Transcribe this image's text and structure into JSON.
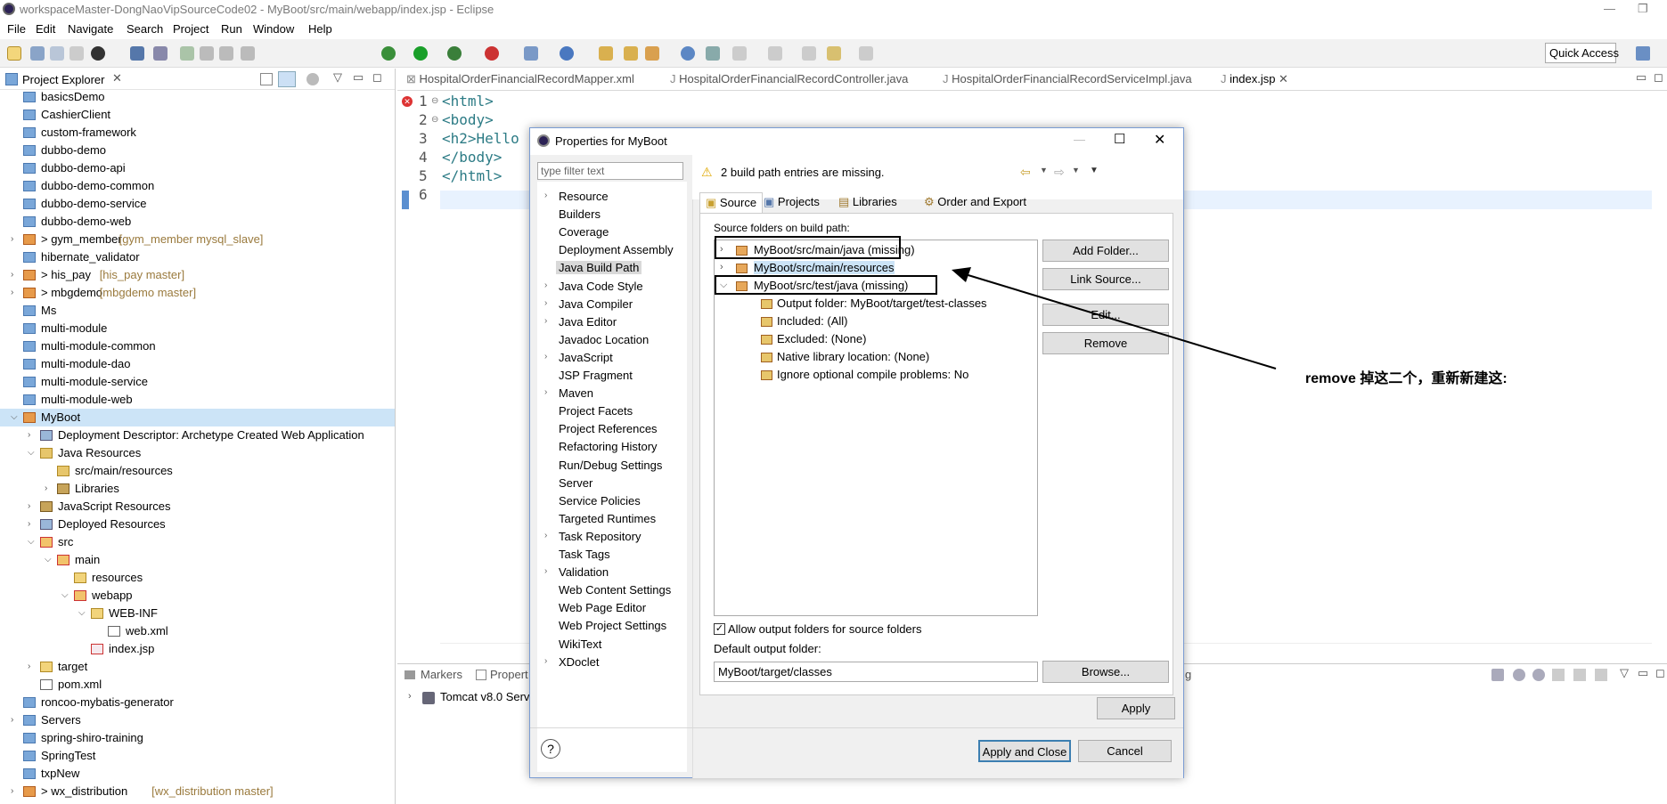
{
  "window": {
    "title": "workspaceMaster-DongNaoVipSourceCode02 - MyBoot/src/main/webapp/index.jsp - Eclipse"
  },
  "menu": [
    "File",
    "Edit",
    "Navigate",
    "Search",
    "Project",
    "Run",
    "Window",
    "Help"
  ],
  "quick_access": "Quick Access",
  "explorer": {
    "title": "Project Explorer",
    "items": [
      {
        "label": "basicsDemo",
        "indent": 0,
        "arrow": "",
        "icon": "proj"
      },
      {
        "label": "CashierClient",
        "indent": 0,
        "arrow": "",
        "icon": "proj"
      },
      {
        "label": "custom-framework",
        "indent": 0,
        "arrow": "",
        "icon": "proj"
      },
      {
        "label": "dubbo-demo",
        "indent": 0,
        "arrow": "",
        "icon": "proj"
      },
      {
        "label": "dubbo-demo-api",
        "indent": 0,
        "arrow": "",
        "icon": "proj"
      },
      {
        "label": "dubbo-demo-common",
        "indent": 0,
        "arrow": "",
        "icon": "proj"
      },
      {
        "label": "dubbo-demo-service",
        "indent": 0,
        "arrow": "",
        "icon": "proj"
      },
      {
        "label": "dubbo-demo-web",
        "indent": 0,
        "arrow": "",
        "icon": "proj"
      },
      {
        "label": "> gym_member",
        "suffix": " [gym_member mysql_slave]",
        "indent": 0,
        "arrow": "›",
        "icon": "maven"
      },
      {
        "label": "hibernate_validator",
        "indent": 0,
        "arrow": "",
        "icon": "proj"
      },
      {
        "label": "> his_pay",
        "suffix": " [his_pay master]",
        "indent": 0,
        "arrow": "›",
        "icon": "maven"
      },
      {
        "label": "> mbgdemo",
        "suffix": " [mbgdemo master]",
        "indent": 0,
        "arrow": "›",
        "icon": "maven"
      },
      {
        "label": "Ms",
        "indent": 0,
        "arrow": "",
        "icon": "proj"
      },
      {
        "label": "multi-module",
        "indent": 0,
        "arrow": "",
        "icon": "proj"
      },
      {
        "label": "multi-module-common",
        "indent": 0,
        "arrow": "",
        "icon": "proj"
      },
      {
        "label": "multi-module-dao",
        "indent": 0,
        "arrow": "",
        "icon": "proj"
      },
      {
        "label": "multi-module-service",
        "indent": 0,
        "arrow": "",
        "icon": "proj"
      },
      {
        "label": "multi-module-web",
        "indent": 0,
        "arrow": "",
        "icon": "proj"
      },
      {
        "label": "MyBoot",
        "indent": 0,
        "arrow": "⌄",
        "icon": "maven",
        "selected": true
      },
      {
        "label": "Deployment Descriptor: Archetype Created Web Application",
        "indent": 1,
        "arrow": "›",
        "icon": "desc"
      },
      {
        "label": "Java Resources",
        "indent": 1,
        "arrow": "⌄",
        "icon": "pkgf"
      },
      {
        "label": "src/main/resources",
        "indent": 2,
        "arrow": "",
        "icon": "pkgf"
      },
      {
        "label": "Libraries",
        "indent": 2,
        "arrow": "›",
        "icon": "lib"
      },
      {
        "label": "JavaScript Resources",
        "indent": 1,
        "arrow": "›",
        "icon": "lib"
      },
      {
        "label": "Deployed Resources",
        "indent": 1,
        "arrow": "›",
        "icon": "desc"
      },
      {
        "label": "src",
        "indent": 1,
        "arrow": "⌄",
        "icon": "redfolder"
      },
      {
        "label": "main",
        "indent": 2,
        "arrow": "⌄",
        "icon": "redfolder"
      },
      {
        "label": "resources",
        "indent": 3,
        "arrow": "",
        "icon": "folder"
      },
      {
        "label": "webapp",
        "indent": 3,
        "arrow": "⌄",
        "icon": "redfolder"
      },
      {
        "label": "WEB-INF",
        "indent": 4,
        "arrow": "⌄",
        "icon": "folder"
      },
      {
        "label": "web.xml",
        "indent": 5,
        "arrow": "",
        "icon": "xml"
      },
      {
        "label": "index.jsp",
        "indent": 4,
        "arrow": "",
        "icon": "jsp"
      },
      {
        "label": "target",
        "indent": 1,
        "arrow": "›",
        "icon": "folder"
      },
      {
        "label": "pom.xml",
        "indent": 1,
        "arrow": "",
        "icon": "pom"
      },
      {
        "label": "roncoo-mybatis-generator",
        "indent": 0,
        "arrow": "",
        "icon": "proj"
      },
      {
        "label": "Servers",
        "indent": 0,
        "arrow": "›",
        "icon": "proj"
      },
      {
        "label": "spring-shiro-training",
        "indent": 0,
        "arrow": "",
        "icon": "proj"
      },
      {
        "label": "SpringTest",
        "indent": 0,
        "arrow": "",
        "icon": "proj"
      },
      {
        "label": "txpNew",
        "indent": 0,
        "arrow": "",
        "icon": "proj"
      },
      {
        "label": "> wx_distribution",
        "suffix": " [wx_distribution master]",
        "indent": 0,
        "arrow": "›",
        "icon": "maven"
      }
    ]
  },
  "editor": {
    "tabs": [
      "HospitalOrderFinancialRecordMapper.xml",
      "HospitalOrderFinancialRecordController.java",
      "HospitalOrderFinancialRecordServiceImpl.java",
      "index.jsp"
    ],
    "lines": [
      {
        "num": "1",
        "text": "<html>"
      },
      {
        "num": "2",
        "text": "<body>"
      },
      {
        "num": "3",
        "text": "<h2>Hello"
      },
      {
        "num": "4",
        "text": "</body>"
      },
      {
        "num": "5",
        "text": "</html>"
      },
      {
        "num": "6",
        "text": ""
      }
    ]
  },
  "bottom": {
    "tab1": "Markers",
    "tab2": "Propert",
    "tab_end": "g",
    "server": "Tomcat v8.0 Serv"
  },
  "dialog": {
    "title": "Properties for MyBoot",
    "filter_placeholder": "type filter text",
    "message": "2 build path entries are missing.",
    "nav": [
      {
        "label": "Resource",
        "arrow": true
      },
      {
        "label": "Builders",
        "arrow": false
      },
      {
        "label": "Coverage",
        "arrow": false
      },
      {
        "label": "Deployment Assembly",
        "arrow": false
      },
      {
        "label": "Java Build Path",
        "arrow": false,
        "selected": true
      },
      {
        "label": "Java Code Style",
        "arrow": true
      },
      {
        "label": "Java Compiler",
        "arrow": true
      },
      {
        "label": "Java Editor",
        "arrow": true
      },
      {
        "label": "Javadoc Location",
        "arrow": false
      },
      {
        "label": "JavaScript",
        "arrow": true
      },
      {
        "label": "JSP Fragment",
        "arrow": false
      },
      {
        "label": "Maven",
        "arrow": true
      },
      {
        "label": "Project Facets",
        "arrow": false
      },
      {
        "label": "Project References",
        "arrow": false
      },
      {
        "label": "Refactoring History",
        "arrow": false
      },
      {
        "label": "Run/Debug Settings",
        "arrow": false
      },
      {
        "label": "Server",
        "arrow": false
      },
      {
        "label": "Service Policies",
        "arrow": false
      },
      {
        "label": "Targeted Runtimes",
        "arrow": false
      },
      {
        "label": "Task Repository",
        "arrow": true
      },
      {
        "label": "Task Tags",
        "arrow": false
      },
      {
        "label": "Validation",
        "arrow": true
      },
      {
        "label": "Web Content Settings",
        "arrow": false
      },
      {
        "label": "Web Page Editor",
        "arrow": false
      },
      {
        "label": "Web Project Settings",
        "arrow": false
      },
      {
        "label": "WikiText",
        "arrow": false
      },
      {
        "label": "XDoclet",
        "arrow": true
      }
    ],
    "tabs": [
      "Source",
      "Projects",
      "Libraries",
      "Order and Export"
    ],
    "source_label": "Source folders on build path:",
    "source_items": [
      {
        "label": "MyBoot/src/main/java (missing)",
        "level": 0,
        "arrow": "›"
      },
      {
        "label": "MyBoot/src/main/resources",
        "level": 0,
        "arrow": "›",
        "highlight": true
      },
      {
        "label": "MyBoot/src/test/java (missing)",
        "level": 0,
        "arrow": "⌄"
      },
      {
        "label": "Output folder: MyBoot/target/test-classes",
        "level": 1,
        "arrow": ""
      },
      {
        "label": "Included: (All)",
        "level": 1,
        "arrow": ""
      },
      {
        "label": "Excluded: (None)",
        "level": 1,
        "arrow": ""
      },
      {
        "label": "Native library location: (None)",
        "level": 1,
        "arrow": ""
      },
      {
        "label": "Ignore optional compile problems: No",
        "level": 1,
        "arrow": ""
      }
    ],
    "buttons": {
      "add_folder": "Add Folder...",
      "link_source": "Link Source...",
      "edit": "Edit...",
      "remove": "Remove",
      "browse": "Browse...",
      "apply": "Apply",
      "apply_close": "Apply and Close",
      "cancel": "Cancel"
    },
    "allow_output": "Allow output folders for source folders",
    "default_output_label": "Default output folder:",
    "default_output_value": "MyBoot/target/classes"
  },
  "annotation": "remove 掉这二个，重新新建这:"
}
